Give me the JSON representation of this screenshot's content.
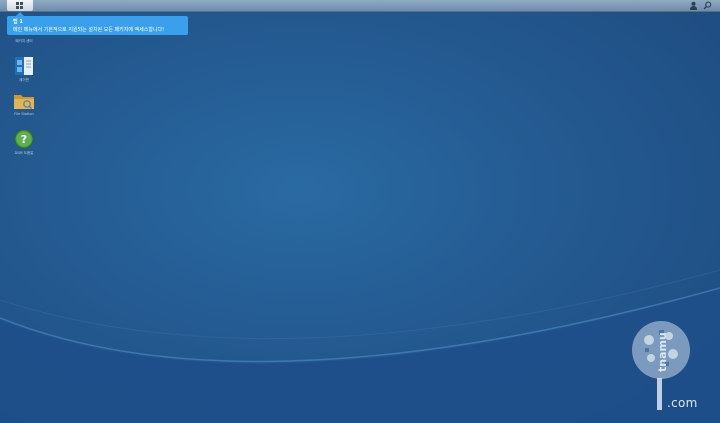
{
  "taskbar": {
    "main_menu_icon": "grid-icon",
    "user_icon": "user-icon",
    "search_icon": "search-icon"
  },
  "tip": {
    "title": "팁 1",
    "body": "메인 메뉴에서 기본적으로 지원되는 설치된 모든 패키지에 액세스합니다!"
  },
  "desktop": {
    "shortcuts": [
      {
        "label": "패키지 센터",
        "icon": "package-center-icon"
      },
      {
        "label": "제어판",
        "icon": "manual-book-icon"
      },
      {
        "label": "File Station",
        "icon": "file-station-folder-icon"
      },
      {
        "label": "DSM 도움말",
        "icon": "help-icon"
      }
    ]
  },
  "watermark": {
    "text": ".com",
    "vertical_text": "tnamu"
  },
  "colors": {
    "desktop_bg": "#23598f",
    "tip_bg": "#3aa0ec",
    "taskbar_bg": "#7f9bb6"
  }
}
